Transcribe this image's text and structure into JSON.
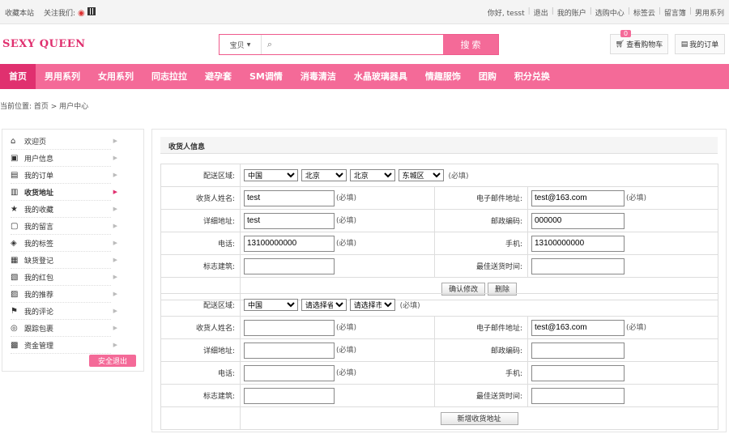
{
  "topbar": {
    "bookmark": "收藏本站",
    "follow": "关注我们:",
    "greeting": "你好, tesst",
    "links": [
      "退出",
      "我的账户",
      "选购中心",
      "标签云",
      "留言簿",
      "男用系列"
    ]
  },
  "header": {
    "logo": "SEXY QUEEN",
    "search_category": "宝贝",
    "search_placeholder": "",
    "search_button": "搜 索",
    "cart_label": "查看购物车",
    "cart_count": "0",
    "orders_label": "我的订单"
  },
  "nav": [
    "首页",
    "男用系列",
    "女用系列",
    "同志拉拉",
    "避孕套",
    "SM调情",
    "消毒清洁",
    "水晶玻璃器具",
    "情趣服饰",
    "团购",
    "积分兑换"
  ],
  "breadcrumb": "当前位置: 首页 > 用户中心",
  "sidebar": {
    "items": [
      {
        "label": "欢迎页",
        "icon": "home-icon",
        "glyph": "⌂"
      },
      {
        "label": "用户信息",
        "icon": "user-card-icon",
        "glyph": "▣"
      },
      {
        "label": "我的订单",
        "icon": "document-icon",
        "glyph": "▤"
      },
      {
        "label": "收货地址",
        "icon": "address-book-icon",
        "glyph": "▥"
      },
      {
        "label": "我的收藏",
        "icon": "star-icon",
        "glyph": "★"
      },
      {
        "label": "我的留言",
        "icon": "message-icon",
        "glyph": "▢"
      },
      {
        "label": "我的标签",
        "icon": "tag-icon",
        "glyph": "◈"
      },
      {
        "label": "缺货登记",
        "icon": "register-icon",
        "glyph": "▦"
      },
      {
        "label": "我的红包",
        "icon": "red-packet-icon",
        "glyph": "▧"
      },
      {
        "label": "我的推荐",
        "icon": "recommend-icon",
        "glyph": "▨"
      },
      {
        "label": "我的评论",
        "icon": "flag-icon",
        "glyph": "⚑"
      },
      {
        "label": "跟踪包裹",
        "icon": "package-icon",
        "glyph": "◎"
      },
      {
        "label": "资金管理",
        "icon": "money-icon",
        "glyph": "▩"
      }
    ],
    "logout_label": "安全退出"
  },
  "panel_title": "收货人信息",
  "labels": {
    "region": "配送区域:",
    "name": "收货人姓名:",
    "email": "电子邮件地址:",
    "address": "详细地址:",
    "zipcode": "邮政编码:",
    "phone": "电话:",
    "mobile": "手机:",
    "landmark": "标志建筑:",
    "best_time": "最佳送货时间:",
    "required": "(必填)"
  },
  "address1": {
    "country": "中国",
    "province": "北京",
    "city": "北京",
    "district": "东城区",
    "name": "test",
    "email": "test@163.com",
    "address": "test",
    "zipcode": "000000",
    "phone": "13100000000",
    "mobile": "13100000000",
    "landmark": "",
    "best_time": "",
    "confirm_button": "确认修改",
    "delete_button": "删除"
  },
  "address2": {
    "country": "中国",
    "province": "请选择省",
    "city": "请选择市",
    "name": "",
    "email": "test@163.com",
    "address": "",
    "zipcode": "",
    "phone": "",
    "mobile": "",
    "landmark": "",
    "best_time": "",
    "add_button": "新增收货地址"
  },
  "colors": {
    "brand_pink": "#f46a98",
    "active_pink": "#e0306f"
  }
}
